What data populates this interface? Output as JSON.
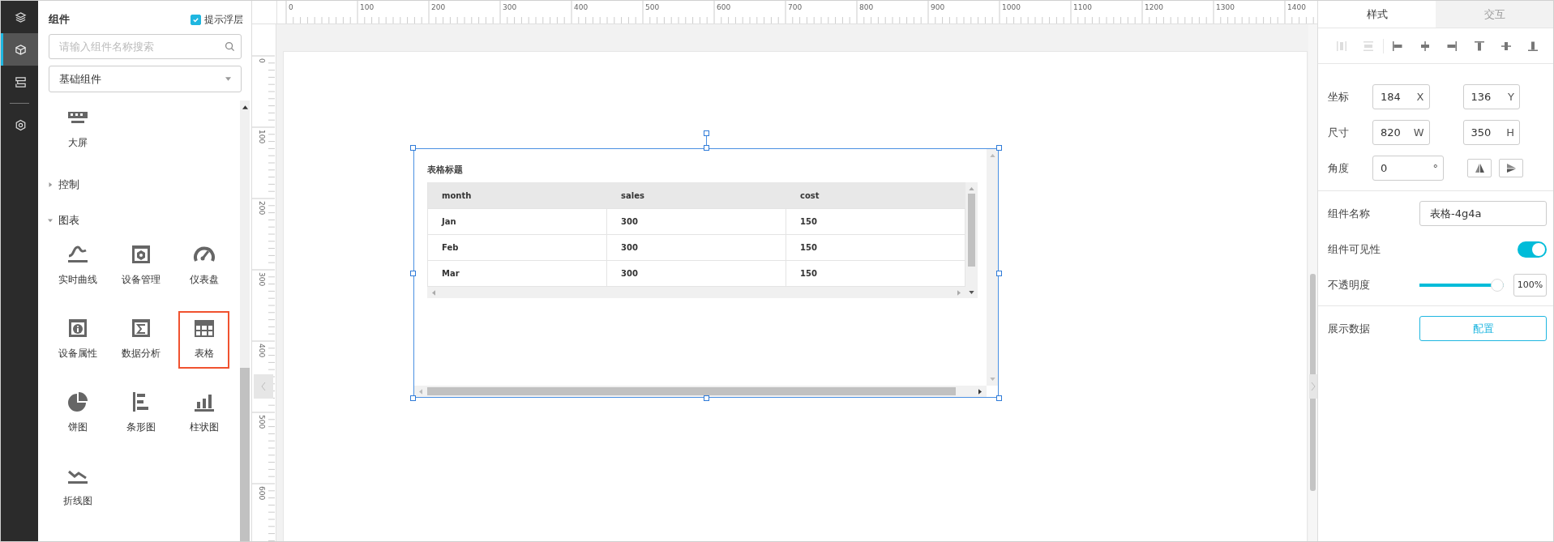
{
  "nav_groups": [
    [
      {
        "kind": "layers",
        "selected": false
      },
      {
        "kind": "cube",
        "selected": true
      },
      {
        "kind": "stack",
        "selected": false
      }
    ],
    [
      {
        "kind": "settings",
        "selected": false
      }
    ]
  ],
  "component_panel": {
    "title": "组件",
    "tooltip_toggle": {
      "label": "提示浮层",
      "checked": true
    },
    "search": {
      "placeholder": "请输入组件名称搜索"
    },
    "library_select": {
      "value": "基础组件"
    },
    "groups": [
      {
        "items": [
          {
            "kind": "screen",
            "label": "大屏",
            "selected": false
          }
        ]
      },
      {
        "title": "控制",
        "expanded": false
      },
      {
        "title": "图表",
        "expanded": true,
        "items": [
          {
            "kind": "curve",
            "label": "实时曲线",
            "selected": false
          },
          {
            "kind": "device",
            "label": "设备管理",
            "selected": false
          },
          {
            "kind": "gauge",
            "label": "仪表盘",
            "selected": false
          },
          {
            "kind": "info",
            "label": "设备属性",
            "selected": false
          },
          {
            "kind": "sigma",
            "label": "数据分析",
            "selected": false
          },
          {
            "kind": "table",
            "label": "表格",
            "selected": true
          },
          {
            "kind": "pie",
            "label": "饼图",
            "selected": false
          },
          {
            "kind": "hbar",
            "label": "条形图",
            "selected": false
          },
          {
            "kind": "bar",
            "label": "柱状图",
            "selected": false
          },
          {
            "kind": "line",
            "label": "折线图",
            "selected": false
          }
        ]
      }
    ]
  },
  "rulers": {
    "horizontal": [
      "0",
      "100",
      "200",
      "300",
      "400",
      "500",
      "600",
      "700",
      "800",
      "900",
      "1000",
      "1100",
      "1200",
      "1300",
      "1400"
    ],
    "vertical": [
      "0",
      "100",
      "200",
      "300",
      "400",
      "500",
      "600"
    ]
  },
  "table_widget": {
    "title": "表格标题",
    "columns": [
      "month",
      "sales",
      "cost"
    ],
    "rows": [
      [
        "Jan",
        "300",
        "150"
      ],
      [
        "Feb",
        "300",
        "150"
      ],
      [
        "Mar",
        "300",
        "150"
      ]
    ]
  },
  "inspector": {
    "tabs": [
      {
        "label": "样式",
        "selected": true
      },
      {
        "label": "交互",
        "selected": false
      }
    ],
    "align_tools": [
      {
        "kind": "distribute-h",
        "disabled": true
      },
      {
        "kind": "distribute-v",
        "disabled": true
      },
      {
        "kind": "align-left",
        "disabled": false
      },
      {
        "kind": "align-center",
        "disabled": false
      },
      {
        "kind": "align-right",
        "disabled": false
      },
      {
        "kind": "align-top",
        "disabled": false
      },
      {
        "kind": "align-middle",
        "disabled": false
      },
      {
        "kind": "align-bottom",
        "disabled": false
      }
    ],
    "geometry": [
      {
        "label": "坐标",
        "fields": [
          {
            "value": "184",
            "unit": "X"
          },
          {
            "value": "136",
            "unit": "Y"
          }
        ]
      },
      {
        "label": "尺寸",
        "fields": [
          {
            "value": "820",
            "unit": "W"
          },
          {
            "value": "350",
            "unit": "H"
          }
        ]
      }
    ],
    "rotation": {
      "label": "角度",
      "value": "0",
      "unit": "°"
    },
    "name": {
      "label": "组件名称",
      "value": "表格-4g4a"
    },
    "visibility": {
      "label": "组件可见性",
      "on": true
    },
    "opacity": {
      "label": "不透明度",
      "level": 1.0,
      "reading": "100%"
    },
    "data": {
      "label": "展示数据",
      "button": "配置"
    }
  }
}
